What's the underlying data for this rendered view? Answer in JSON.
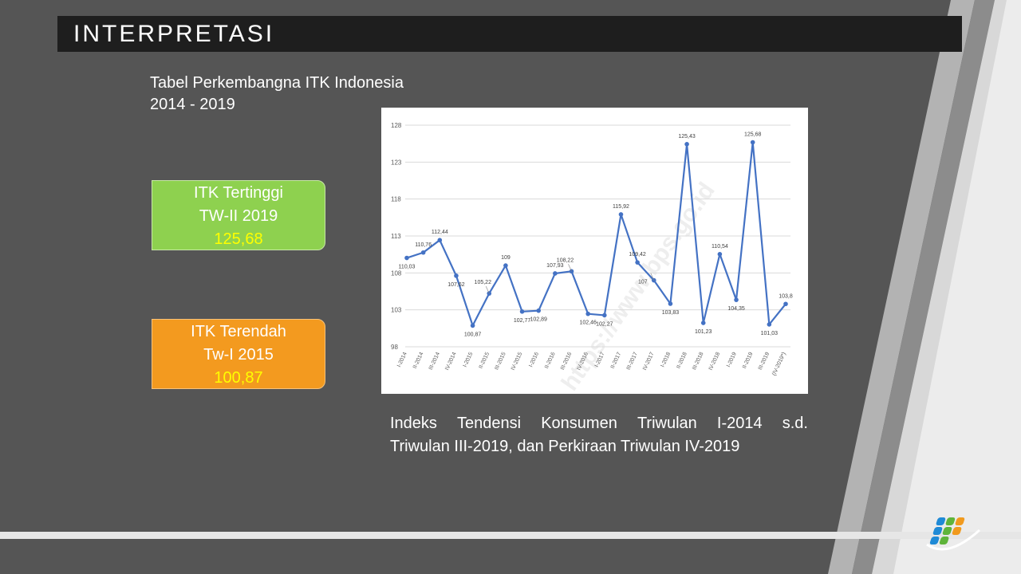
{
  "header": {
    "title": "INTERPRETASI"
  },
  "subtitle": {
    "line1": "Tabel Perkembangna ITK Indonesia",
    "line2": "2014 - 2019"
  },
  "highlight_high": {
    "line1": "ITK  Tertinggi",
    "line2": "TW-II 2019",
    "value": "125,68"
  },
  "highlight_low": {
    "line1": "ITK  Terendah",
    "line2": "Tw-I 2015",
    "value": "100,87"
  },
  "caption": {
    "line1_words": [
      "Indeks",
      "Tendensi",
      "Konsumen",
      "Triwulan",
      "I-2014",
      "s.d."
    ],
    "line2": "Triwulan III-2019, dan Perkiraan Triwulan IV-2019"
  },
  "colors": {
    "background": "#555555",
    "title_bar": "#1e1e1e",
    "highest_box": "#8ed14f",
    "lowest_box": "#f39a1f",
    "value_text": "#ffff00",
    "series_line": "#4472c4"
  },
  "chart_data": {
    "type": "line",
    "watermark": "https://www.bps.go.id",
    "ylim": [
      98,
      128
    ],
    "yticks": [
      98,
      103,
      108,
      113,
      118,
      123,
      128
    ],
    "grid": true,
    "categories": [
      "I-2014",
      "II-2014",
      "III-2014",
      "IV-2014",
      "I-2015",
      "II-2015",
      "III-2015",
      "IV-2015",
      "I-2016",
      "II-2016",
      "III-2016",
      "IV-2016",
      "I-2017",
      "II-2017",
      "III-2017",
      "IV-2017",
      "I-2018",
      "II-2018",
      "III-2018",
      "IV-2018",
      "I-2019",
      "II-2019",
      "III-2019",
      "(IV-2019*)"
    ],
    "values": [
      110.03,
      110.76,
      112.44,
      107.62,
      100.87,
      105.22,
      109,
      102.77,
      102.89,
      107.93,
      108.22,
      102.46,
      102.27,
      115.92,
      109.42,
      107,
      103.83,
      125.43,
      101.23,
      110.54,
      104.35,
      125.68,
      101.03,
      103.8
    ],
    "point_labels": [
      "110,03",
      "110,76",
      "112,44",
      "107,62",
      "100,87",
      "105,22",
      "109",
      "102,77",
      "102,89",
      "107,93",
      "108,22",
      "102,46",
      "102,27",
      "115,92",
      "109,42",
      "107",
      "103,83",
      "125,43",
      "101,23",
      "110,54",
      "104,35",
      "125,68",
      "101,03",
      "103,8"
    ]
  }
}
